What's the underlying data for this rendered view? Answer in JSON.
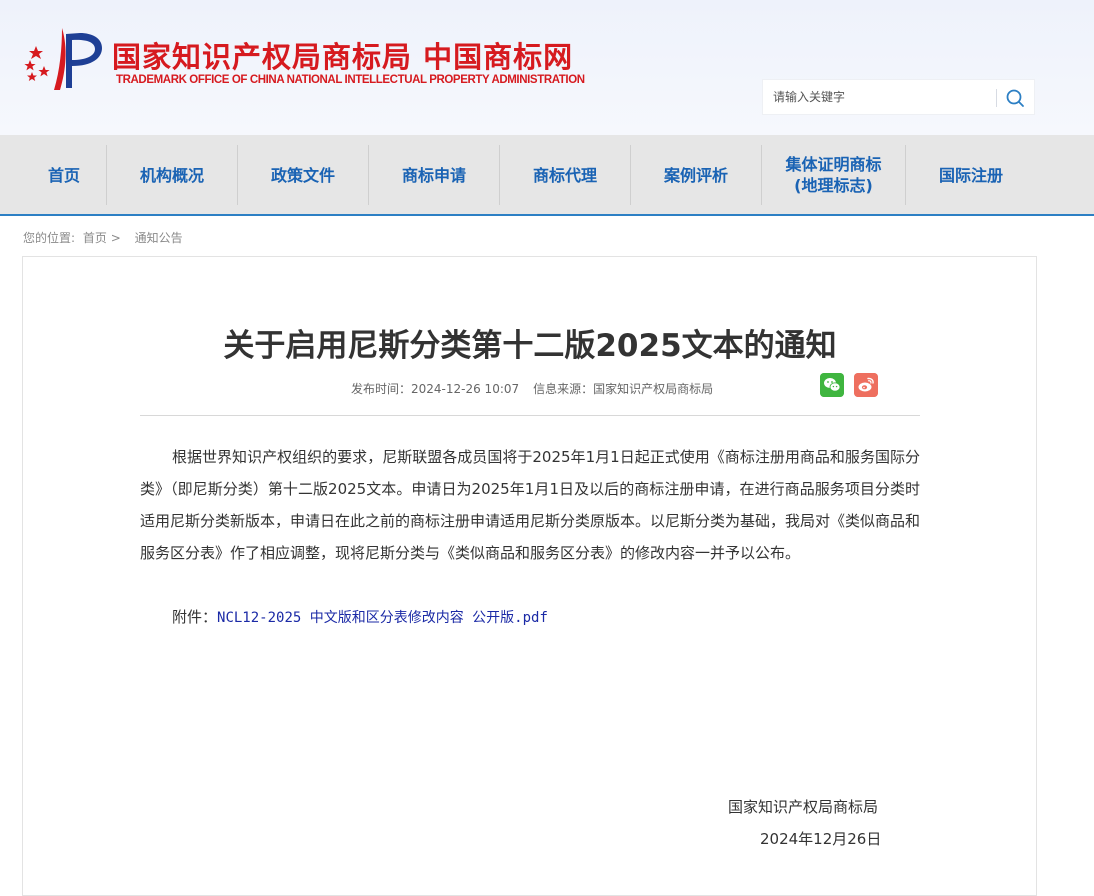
{
  "header": {
    "site_name_cn": "国家知识产权局商标局 中国商标网",
    "site_name_en": "TRADEMARK OFFICE OF CHINA NATIONAL INTELLECTUAL PROPERTY ADMINISTRATION",
    "search_placeholder": "请输入关键字"
  },
  "nav": {
    "items": [
      {
        "label": "首页"
      },
      {
        "label": "机构概况"
      },
      {
        "label": "政策文件"
      },
      {
        "label": "商标申请"
      },
      {
        "label": "商标代理"
      },
      {
        "label": "案例评析"
      },
      {
        "label": "集体证明商标\n(地理标志)"
      },
      {
        "label": "国际注册"
      }
    ]
  },
  "breadcrumb": {
    "prefix": "您的位置:",
    "home": "首页",
    "sep": ">",
    "current": "通知公告"
  },
  "article": {
    "title": "关于启用尼斯分类第十二版2025文本的通知",
    "publish_time": "发布时间：2024-12-26 10:07",
    "source": "信息来源：国家知识产权局商标局",
    "body": "根据世界知识产权组织的要求，尼斯联盟各成员国将于2025年1月1日起正式使用《商标注册用商品和服务国际分类》（即尼斯分类）第十二版2025文本。申请日为2025年1月1日及以后的商标注册申请，在进行商品服务项目分类时适用尼斯分类新版本，申请日在此之前的商标注册申请适用尼斯分类原版本。以尼斯分类为基础，我局对《类似商品和服务区分表》作了相应调整，现将尼斯分类与《类似商品和服务区分表》的修改内容一并予以公布。",
    "attachment_label": "附件：",
    "attachment_link": "NCL12-2025 中文版和区分表修改内容 公开版.pdf",
    "signature_org": "国家知识产权局商标局",
    "signature_date": "2024年12月26日"
  },
  "colors": {
    "brand_red": "#d61a1f",
    "nav_text": "#1a63b4",
    "nav_border": "#2c7fc4",
    "link": "#1b2aa6",
    "wechat": "#3fb53f",
    "weibo": "#ee6f5f"
  },
  "icons": {
    "logo": "cnipa-emblem-icon",
    "search": "search-icon",
    "wechat": "wechat-icon",
    "weibo": "weibo-icon"
  }
}
